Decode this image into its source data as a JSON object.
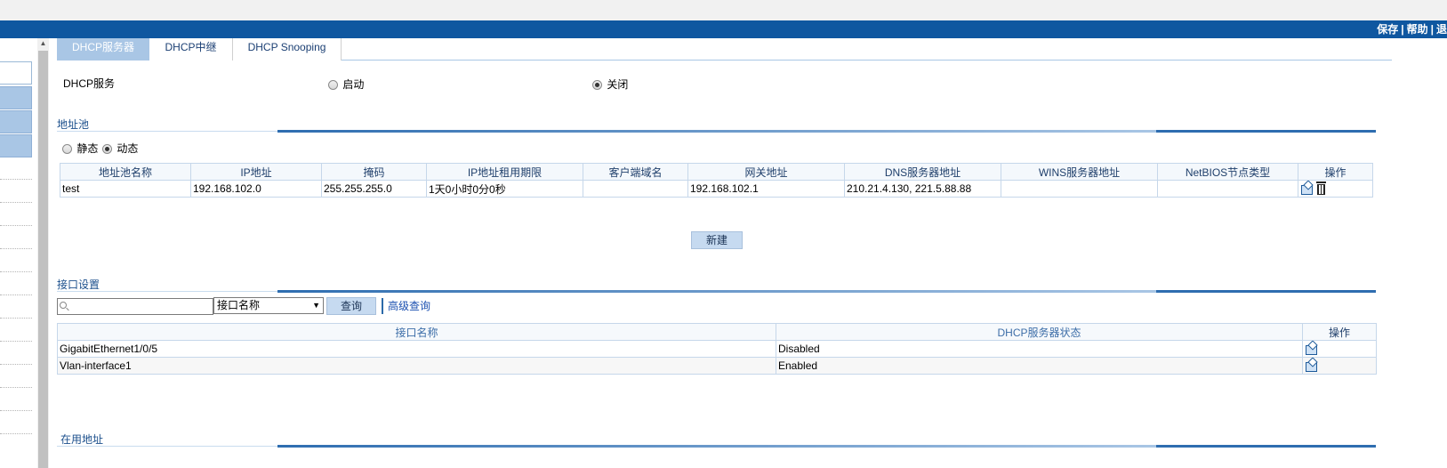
{
  "header": {
    "links": [
      "保存",
      "帮助",
      "退"
    ]
  },
  "tabs": [
    {
      "label": "DHCP服务器",
      "active": true
    },
    {
      "label": "DHCP中继",
      "active": false
    },
    {
      "label": "DHCP Snooping",
      "active": false
    }
  ],
  "dhcp_service": {
    "label": "DHCP服务",
    "options": [
      {
        "label": "启动",
        "checked": false
      },
      {
        "label": "关闭",
        "checked": true
      }
    ]
  },
  "address_pool": {
    "title": "地址池",
    "mode_options": [
      {
        "label": "静态",
        "checked": false
      },
      {
        "label": "动态",
        "checked": true
      }
    ],
    "columns": [
      "地址池名称",
      "IP地址",
      "掩码",
      "IP地址租用期限",
      "客户端域名",
      "网关地址",
      "DNS服务器地址",
      "WINS服务器地址",
      "NetBIOS节点类型",
      "操作"
    ],
    "rows": [
      [
        "test",
        "192.168.102.0",
        "255.255.255.0",
        "1天0小时0分0秒",
        "",
        "192.168.102.1",
        "210.21.4.130, 221.5.88.88",
        "",
        ""
      ]
    ],
    "new_button": "新建"
  },
  "interface_settings": {
    "title": "接口设置",
    "search": {
      "value": "",
      "placeholder": ""
    },
    "select": {
      "value": "接口名称"
    },
    "query_button": "查询",
    "advanced_link": "高级查询",
    "columns": [
      "接口名称",
      "DHCP服务器状态",
      "操作"
    ],
    "rows": [
      [
        "GigabitEthernet1/0/5",
        "Disabled"
      ],
      [
        "Vlan-interface1",
        "Enabled"
      ]
    ]
  },
  "used_addresses": {
    "title": "在用地址"
  },
  "colors": {
    "header_bar": "#0f57a0",
    "tab_active": "#a9c6e5",
    "section_accent": "#2e6db0"
  }
}
